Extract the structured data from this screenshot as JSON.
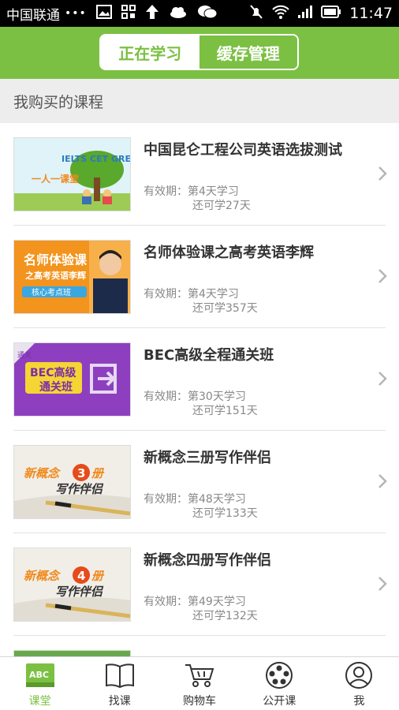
{
  "status_bar": {
    "carrier": "中国联通",
    "dots": "•••",
    "time": "11:47"
  },
  "header": {
    "tabs": [
      {
        "label": "正在学习",
        "active": true
      },
      {
        "label": "缓存管理",
        "active": false
      }
    ],
    "accent_color": "#7bc043"
  },
  "section": {
    "title": "我购买的课程"
  },
  "courses": [
    {
      "title": "中国昆仑工程公司英语选拔测试",
      "valid": "有效期：第4天学习",
      "remain": "还可学27天",
      "thumb": {
        "banner": "一人一课堂",
        "words": "IELTS CET GRE"
      }
    },
    {
      "title": "名师体验课之高考英语李辉",
      "valid": "有效期：第4天学习",
      "remain": "还可学357天",
      "thumb": {
        "line1": "名师体验课",
        "line2": "之高考英语李辉",
        "line3": "核心考点班"
      }
    },
    {
      "title": "BEC高级全程通关班",
      "valid": "有效期：第30天学习",
      "remain": "还可学151天",
      "thumb": {
        "corner": "通关",
        "line1": "BEC高级",
        "line2": "通关班"
      }
    },
    {
      "title": "新概念三册写作伴侣",
      "valid": "有效期：第48天学习",
      "remain": "还可学133天",
      "thumb": {
        "line1a": "新概念",
        "num": "3",
        "line1b": "册",
        "line2": "写作伴侣"
      }
    },
    {
      "title": "新概念四册写作伴侣",
      "valid": "有效期：第49天学习",
      "remain": "还可学132天",
      "thumb": {
        "line1a": "新概念",
        "num": "4",
        "line1b": "册",
        "line2": "写作伴侣"
      }
    }
  ],
  "bottom_nav": [
    {
      "label": "课堂",
      "icon": "abc-book-icon",
      "active": true,
      "icon_text": "ABC"
    },
    {
      "label": "找课",
      "icon": "open-book-icon",
      "active": false
    },
    {
      "label": "购物车",
      "icon": "cart-icon",
      "active": false
    },
    {
      "label": "公开课",
      "icon": "film-reel-icon",
      "active": false
    },
    {
      "label": "我",
      "icon": "person-icon",
      "active": false
    }
  ]
}
